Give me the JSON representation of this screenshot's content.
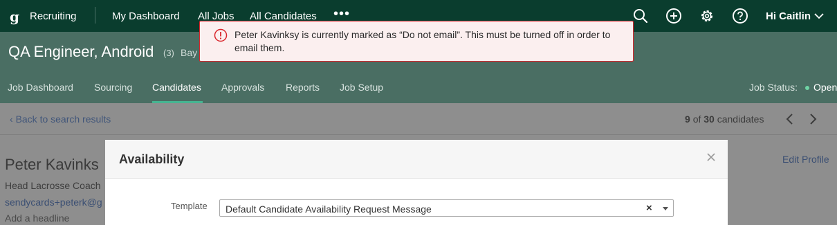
{
  "topnav": {
    "logo_glyph": "g",
    "app_name": "Recruiting",
    "links": [
      "My Dashboard",
      "All Jobs",
      "All Candidates"
    ],
    "more_glyph": "•••",
    "icons": [
      "search-icon",
      "plus-circle-icon",
      "gear-icon",
      "help-icon"
    ],
    "greeting": "Hi Caitlin"
  },
  "job": {
    "title": "QA Engineer, Android",
    "count": "(3)",
    "location": "Bay",
    "tabs": [
      "Job Dashboard",
      "Sourcing",
      "Candidates",
      "Approvals",
      "Reports",
      "Job Setup"
    ],
    "active_tab": "Candidates",
    "status_label": "Job Status:",
    "status_value": "Open"
  },
  "candidate_nav": {
    "back_label": "Back to search results",
    "current": "9",
    "of": "of",
    "total": "30",
    "suffix": "candidates"
  },
  "candidate": {
    "name": "Peter Kavinks",
    "role": "Head Lacrosse Coach",
    "email": "sendycards+peterk@g",
    "headline_placeholder": "Add a headline",
    "edit_label": "Edit Profile"
  },
  "modal": {
    "title": "Availability",
    "template_label": "Template",
    "template_value": "Default Candidate Availability Request Message"
  },
  "alert": {
    "message": "Peter Kavinksy is currently marked as “Do not email”. This must be turned off in order to email them."
  },
  "colors": {
    "nav_bg": "#0a3d2e",
    "header_bg": "#4a6e63",
    "accent": "#46b491",
    "alert_border": "#d9262c",
    "alert_bg": "#fbefef"
  }
}
